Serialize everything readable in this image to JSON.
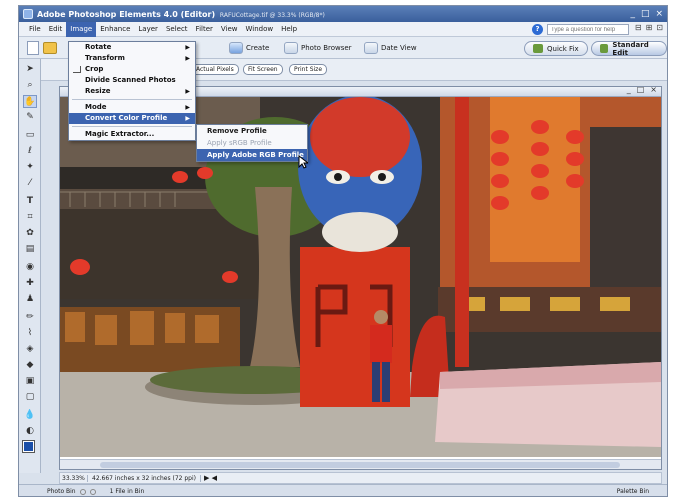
{
  "window": {
    "title": "Adobe Photoshop Elements 4.0 (Editor)",
    "document_name": "RAFUCottage.tif @ 33.3% (RGB/8*)",
    "controls": [
      "_",
      "□",
      "×"
    ]
  },
  "menubar": {
    "items": [
      "File",
      "Edit",
      "Image",
      "Enhance",
      "Layer",
      "Select",
      "Filter",
      "View",
      "Window",
      "Help"
    ],
    "active": "Image",
    "help_placeholder": "Type a question for help"
  },
  "shortcuts": {
    "create": "Create",
    "photo_browser": "Photo Browser",
    "date_view": "Date View",
    "quick_fix": "Quick Fix",
    "standard_edit": "Standard Edit"
  },
  "options_bar": {
    "buttons": [
      "Actual Pixels",
      "Fit Screen",
      "Print Size"
    ]
  },
  "image_menu": {
    "items": [
      {
        "label": "Rotate",
        "submenu": true
      },
      {
        "label": "Transform",
        "submenu": true
      },
      {
        "label": "Crop",
        "submenu": false
      },
      {
        "label": "Divide Scanned Photos",
        "submenu": false
      },
      {
        "label": "Resize",
        "submenu": true
      },
      {
        "label": "Mode",
        "submenu": true
      },
      {
        "label": "Convert Color Profile",
        "submenu": true
      },
      {
        "label": "Magic Extractor...",
        "submenu": false
      }
    ],
    "highlighted": "Convert Color Profile"
  },
  "color_profile_submenu": {
    "items": [
      {
        "label": "Remove Profile",
        "enabled": true
      },
      {
        "label": "Apply sRGB Profile",
        "enabled": false
      },
      {
        "label": "Apply Adobe RGB Profile",
        "enabled": true
      }
    ],
    "highlighted": "Apply Adobe RGB Profile"
  },
  "statusbar": {
    "zoom": "33.33%",
    "doc_info": "42.667 inches x 32 inches (72 ppi)"
  },
  "bottom": {
    "photo_bin": "Photo Bin",
    "file_count": "1 File in Bin",
    "palette_bin": "Palette Bin"
  },
  "colors": {
    "accent": "#3c64b0",
    "foreground_swatch": "#1b4fa8",
    "background_swatch": "#ffffff"
  }
}
